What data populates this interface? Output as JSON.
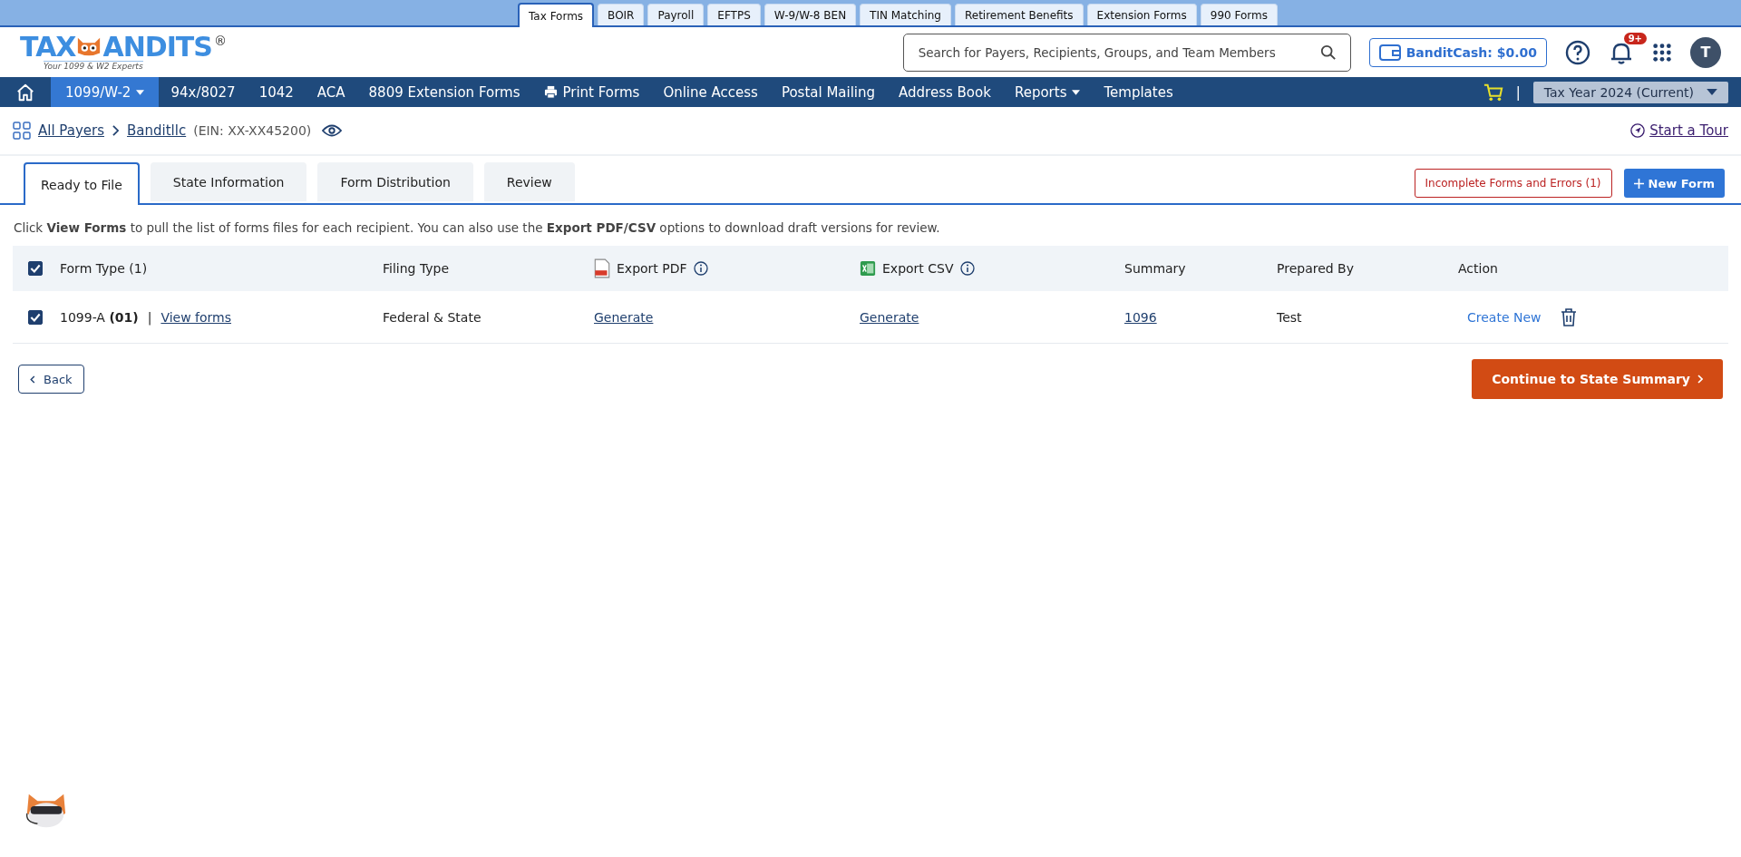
{
  "product_tabs": [
    {
      "label": "Tax Forms",
      "selected": true
    },
    {
      "label": "BOIR",
      "selected": false
    },
    {
      "label": "Payroll",
      "selected": false
    },
    {
      "label": "EFTPS",
      "selected": false
    },
    {
      "label": "W-9/W-8 BEN",
      "selected": false
    },
    {
      "label": "TIN Matching",
      "selected": false
    },
    {
      "label": "Retirement Benefits",
      "selected": false
    },
    {
      "label": "Extension Forms",
      "selected": false
    },
    {
      "label": "990 Forms",
      "selected": false
    }
  ],
  "logo": {
    "left": "TAX",
    "right": "ANDITS",
    "mark": "®",
    "tagline": "Your 1099 & W2 Experts"
  },
  "search": {
    "placeholder": "Search for Payers, Recipients, Groups, and Team Members"
  },
  "bandit_cash": "BanditCash: $0.00",
  "notifications_badge": "9+",
  "avatar": "T",
  "nav": [
    {
      "label": "1099/W-2",
      "selected": true,
      "kind": "dropdown"
    },
    {
      "label": "94x/8027",
      "selected": false,
      "kind": "link"
    },
    {
      "label": "1042",
      "selected": false,
      "kind": "link"
    },
    {
      "label": "ACA",
      "selected": false,
      "kind": "link"
    },
    {
      "label": "8809 Extension Forms",
      "selected": false,
      "kind": "link"
    },
    {
      "label": "Print Forms",
      "selected": false,
      "kind": "print"
    },
    {
      "label": "Online Access",
      "selected": false,
      "kind": "link"
    },
    {
      "label": "Postal Mailing",
      "selected": false,
      "kind": "link"
    },
    {
      "label": "Address Book",
      "selected": false,
      "kind": "link"
    },
    {
      "label": "Reports",
      "selected": false,
      "kind": "dropdown"
    },
    {
      "label": "Templates",
      "selected": false,
      "kind": "link"
    }
  ],
  "nav_separator": "|",
  "tax_year": "Tax Year 2024 (Current)",
  "breadcrumb": {
    "root": "All Payers",
    "payer": "Banditllc",
    "ein": "(EIN: XX-XX45200)"
  },
  "tour": "Start a Tour",
  "tabs": [
    {
      "label": "Ready to File",
      "selected": true
    },
    {
      "label": "State Information",
      "selected": false
    },
    {
      "label": "Form Distribution",
      "selected": false
    },
    {
      "label": "Review",
      "selected": false
    }
  ],
  "errors_button": "Incomplete Forms and Errors (1)",
  "new_form_button": "New Form",
  "info": "Click **View Forms** to pull the list of forms files for each recipient. You can also use the **Export PDF/CSV** options to download draft versions for review.",
  "table": {
    "all_checked": true,
    "columns": [
      {
        "label": "Form Type  (1)",
        "kind": "text"
      },
      {
        "label": "Filing Type",
        "kind": "text"
      },
      {
        "label": "Export PDF",
        "kind": "pdf"
      },
      {
        "label": "Export CSV",
        "kind": "csv"
      },
      {
        "label": "Summary",
        "kind": "text"
      },
      {
        "label": "Prepared By",
        "kind": "text"
      },
      {
        "label": "Action",
        "kind": "text"
      }
    ],
    "rows": [
      {
        "checked": true,
        "form_type": "1099-A",
        "form_count": "(01)",
        "separator": "|",
        "view_link": "View forms",
        "filing_type": "Federal & State",
        "export_pdf": "Generate",
        "export_csv": "Generate",
        "summary": "1096",
        "prepared_by": "Test",
        "action": "Create New"
      }
    ]
  },
  "back_button": "Back",
  "continue_button": "Continue to State Summary"
}
